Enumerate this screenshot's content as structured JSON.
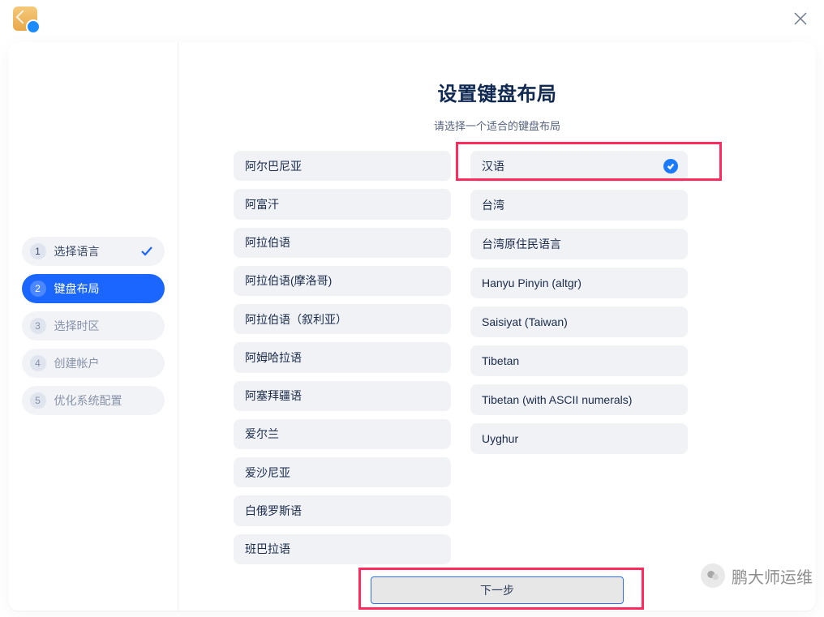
{
  "window": {
    "close_icon": "close"
  },
  "sidebar": {
    "steps": [
      {
        "num": "1",
        "label": "选择语言",
        "state": "done"
      },
      {
        "num": "2",
        "label": "键盘布局",
        "state": "active"
      },
      {
        "num": "3",
        "label": "选择时区",
        "state": "pending"
      },
      {
        "num": "4",
        "label": "创建帐户",
        "state": "pending"
      },
      {
        "num": "5",
        "label": "优化系统配置",
        "state": "pending"
      }
    ]
  },
  "main": {
    "title": "设置键盘布局",
    "subtitle": "请选择一个适合的键盘布局",
    "left_options": [
      "阿尔巴尼亚",
      "阿富汗",
      "阿拉伯语",
      "阿拉伯语(摩洛哥)",
      "阿拉伯语（叙利亚）",
      "阿姆哈拉语",
      "阿塞拜疆语",
      "爱尔兰",
      "爱沙尼亚",
      "白俄罗斯语",
      "班巴拉语"
    ],
    "right_options": [
      {
        "label": "汉语",
        "selected": true
      },
      {
        "label": "台湾",
        "selected": false
      },
      {
        "label": "台湾原住民语言",
        "selected": false
      },
      {
        "label": "Hanyu Pinyin (altgr)",
        "selected": false
      },
      {
        "label": "Saisiyat (Taiwan)",
        "selected": false
      },
      {
        "label": "Tibetan",
        "selected": false
      },
      {
        "label": "Tibetan (with ASCII numerals)",
        "selected": false
      },
      {
        "label": "Uyghur",
        "selected": false
      }
    ],
    "next_label": "下一步"
  },
  "watermark": {
    "text": "鹏大师运维"
  }
}
